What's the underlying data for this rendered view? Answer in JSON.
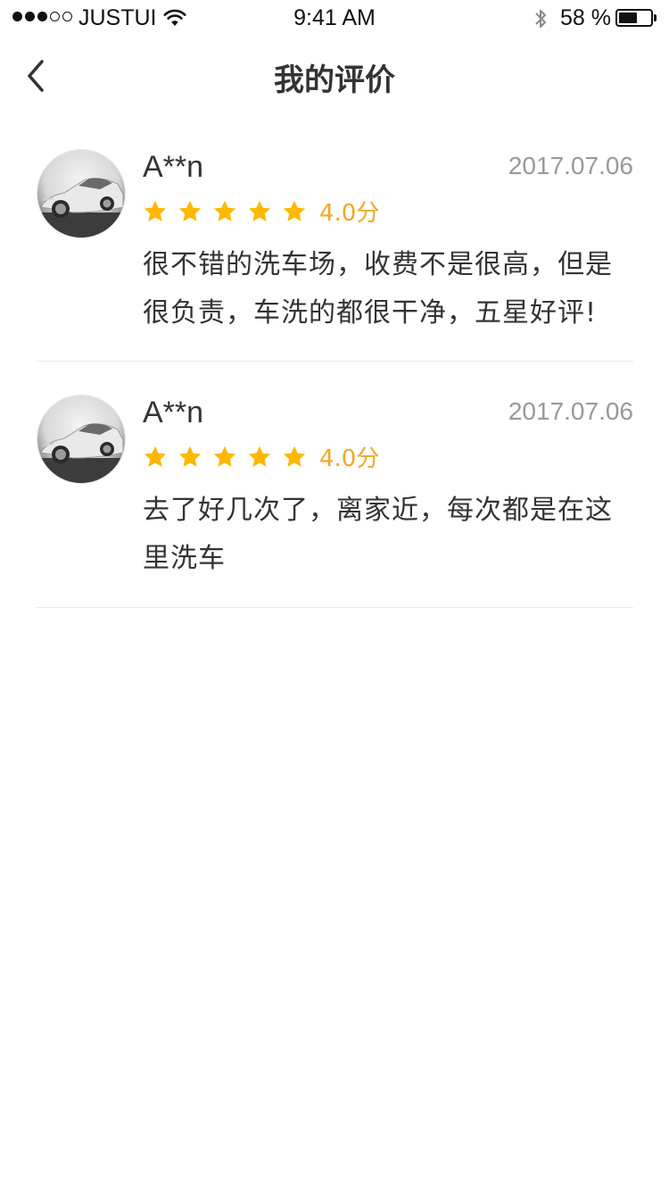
{
  "status_bar": {
    "carrier": "JUSTUI",
    "time": "9:41 AM",
    "battery_percent": "58 %",
    "battery_level": 0.58,
    "signal_bars_filled": 3,
    "signal_bars_total": 5
  },
  "nav": {
    "title": "我的评价",
    "back_icon": "chevron-left-icon"
  },
  "colors": {
    "star": "#ffb800",
    "score": "#f5a623",
    "date": "#999999",
    "text": "#333333",
    "divider": "#e9e9e9"
  },
  "reviews": [
    {
      "username": "A**n",
      "date": "2017.07.06",
      "stars": 5,
      "score": "4.0分",
      "content": "很不错的洗车场，收费不是很高，但是很负责，车洗的都很干净，五星好评!",
      "avatar_icon": "car-avatar"
    },
    {
      "username": "A**n",
      "date": "2017.07.06",
      "stars": 5,
      "score": "4.0分",
      "content": "去了好几次了，离家近，每次都是在这里洗车",
      "avatar_icon": "car-avatar"
    }
  ]
}
